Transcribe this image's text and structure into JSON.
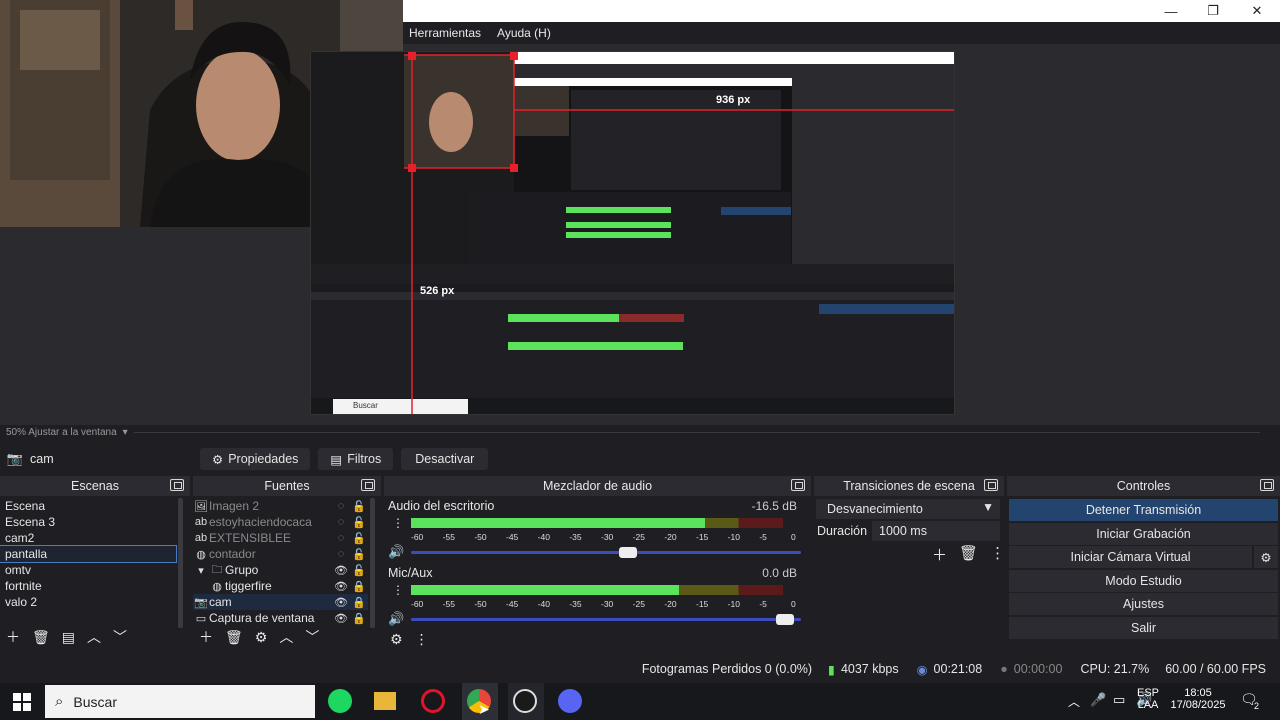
{
  "menu": {
    "tools": "Herramientas",
    "help": "Ayuda (H)"
  },
  "preview": {
    "scale_label": "50% Ajustar a la ventana",
    "width_readout": "936 px",
    "height_readout": "526 px",
    "nested_search": "Buscar"
  },
  "source_toolbar": {
    "source_name": "cam",
    "properties": "Propiedades",
    "filters": "Filtros",
    "deactivate": "Desactivar"
  },
  "scenes": {
    "title": "Escenas",
    "items": [
      "Escena",
      "Escena 3",
      "cam2",
      "pantalla",
      "omtv",
      "fortnite",
      "valo 2"
    ]
  },
  "sources": {
    "title": "Fuentes",
    "items": [
      "Imagen 2",
      "estoyhaciendocaca",
      "EXTENSIBLEE",
      "contador",
      "Grupo",
      "tiggerfire",
      "cam",
      "Captura de ventana"
    ]
  },
  "mixer": {
    "title": "Mezclador de audio",
    "channels": [
      {
        "name": "Audio del escritorio",
        "db": "-16.5 dB",
        "level": 0.79,
        "volume": 0.56
      },
      {
        "name": "Mic/Aux",
        "db": "0.0 dB",
        "level": 0.72,
        "volume": 0.98
      }
    ],
    "scale": [
      "-60",
      "-55",
      "-50",
      "-45",
      "-40",
      "-35",
      "-30",
      "-25",
      "-20",
      "-15",
      "-10",
      "-5",
      "0"
    ]
  },
  "transitions": {
    "title": "Transiciones de escena",
    "selected": "Desvanecimiento",
    "duration_label": "Duración",
    "duration_value": "1000 ms"
  },
  "controls": {
    "title": "Controles",
    "buttons": [
      "Detener Transmisión",
      "Iniciar Grabación",
      "Iniciar Cámara Virtual",
      "Modo Estudio",
      "Ajustes",
      "Salir"
    ]
  },
  "status": {
    "dropped": "Fotogramas Perdidos 0 (0.0%)",
    "bitrate": "4037 kbps",
    "stream_time": "00:21:08",
    "rec_time": "00:00:00",
    "cpu": "CPU: 21.7%",
    "fps": "60.00 / 60.00 FPS"
  },
  "taskbar": {
    "search": "Buscar",
    "lang": "ESP",
    "lang2": "LAA",
    "time": "18:05",
    "date": "17/08/2025",
    "notif": "2"
  },
  "colors": {
    "accent": "#22446e",
    "meter_green": "#5ce35c",
    "guide_red": "#e8202a"
  }
}
